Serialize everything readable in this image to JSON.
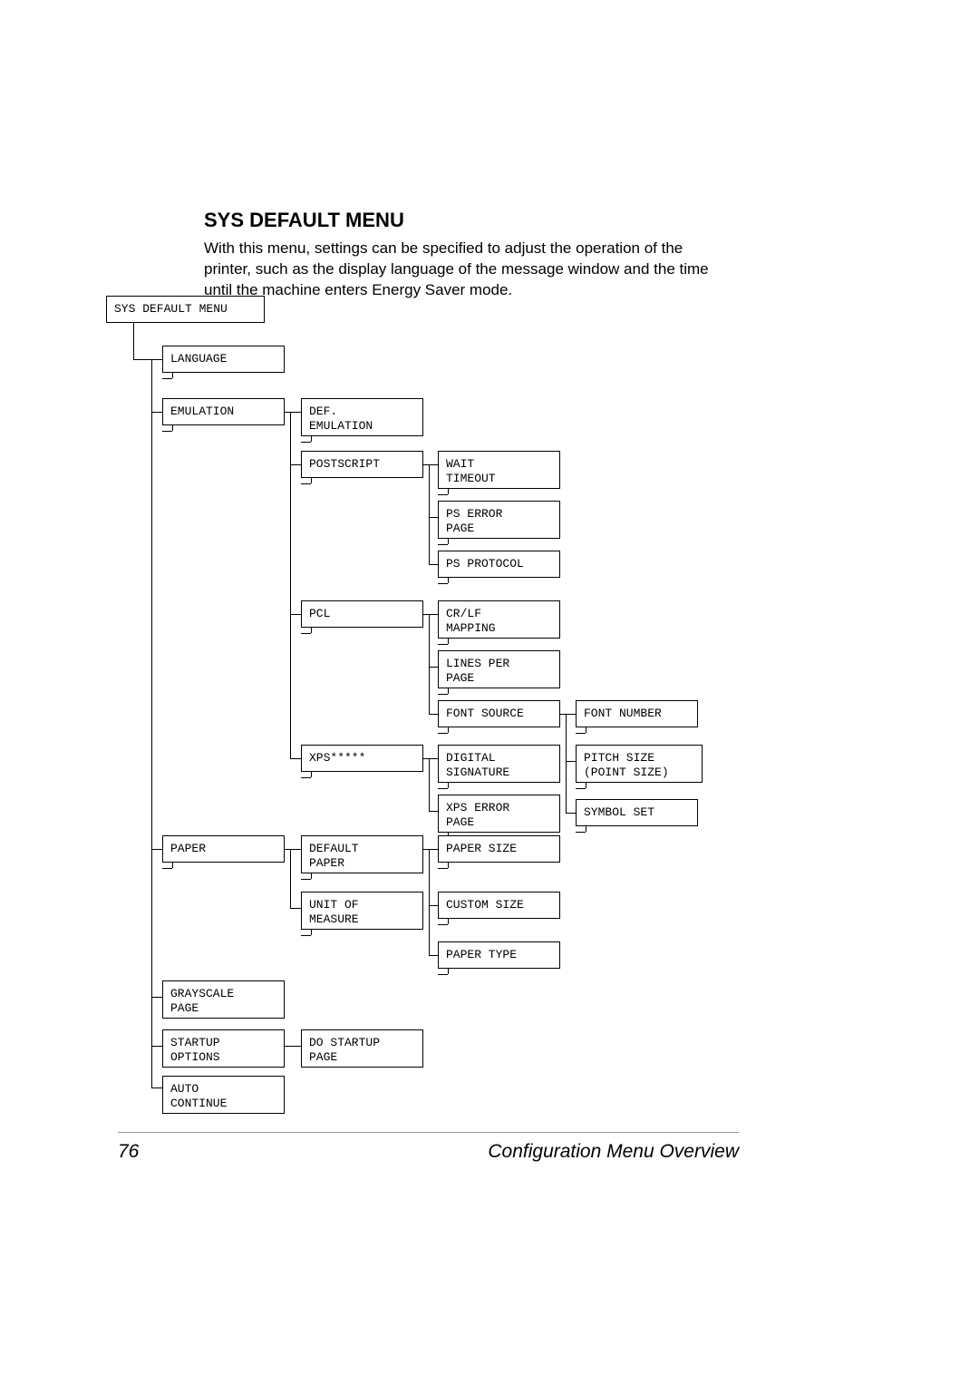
{
  "heading": "SYS DEFAULT MENU",
  "intro": "With this menu, settings can be specified to adjust the operation of the printer, such as the display language of the message window and the time until the machine enters Energy Saver mode.",
  "root": "SYS DEFAULT MENU",
  "col1": {
    "language": "LANGUAGE",
    "emulation": "EMULATION",
    "paper": "PAPER",
    "grayscale": "GRAYSCALE\nPAGE",
    "startup": "STARTUP\nOPTIONS",
    "auto": "AUTO\nCONTINUE"
  },
  "col2": {
    "defemu": "DEF.\nEMULATION",
    "postscript": "POSTSCRIPT",
    "pcl": "PCL",
    "xps": "XPS*****",
    "defpaper": "DEFAULT\nPAPER",
    "unit": "UNIT OF\nMEASURE",
    "dostartup": "DO STARTUP\nPAGE"
  },
  "col3": {
    "wait": "WAIT\nTIMEOUT",
    "pserr": "PS ERROR\nPAGE",
    "psproto": "PS PROTOCOL",
    "crlf": "CR/LF\nMAPPING",
    "lines": "LINES PER\nPAGE",
    "fontsrc": "FONT SOURCE",
    "digital": "DIGITAL\nSIGNATURE",
    "xpserr": "XPS ERROR\nPAGE",
    "papersize": "PAPER SIZE",
    "custom": "CUSTOM SIZE",
    "papertype": "PAPER TYPE"
  },
  "col4": {
    "fontnum": "FONT NUMBER",
    "pitch": "PITCH SIZE\n(POINT SIZE)",
    "symbol": "SYMBOL SET"
  },
  "page_number": "76",
  "footer_title": "Configuration Menu Overview"
}
